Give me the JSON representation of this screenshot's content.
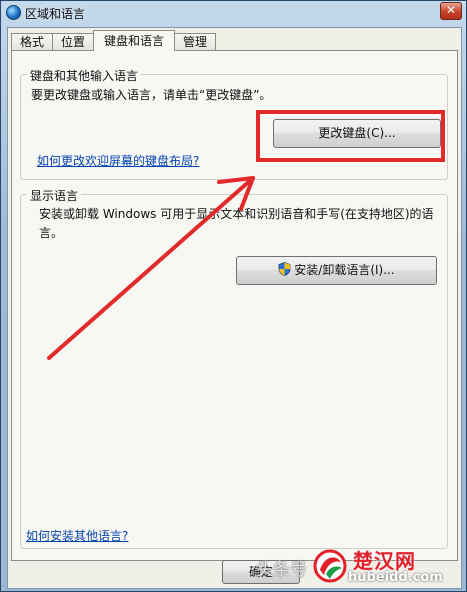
{
  "window": {
    "title": "区域和语言",
    "close_glyph": "✕"
  },
  "tabs": [
    {
      "label": "格式"
    },
    {
      "label": "位置"
    },
    {
      "label": "键盘和语言",
      "active": true
    },
    {
      "label": "管理"
    }
  ],
  "keyboard_group": {
    "title": "键盘和其他输入语言",
    "description": "要更改键盘或输入语言，请单击“更改键盘”。",
    "change_keyboard_button": "更改键盘(C)...",
    "welcome_layout_link": "如何更改欢迎屏幕的键盘布局?"
  },
  "display_language_group": {
    "title": "显示语言",
    "description_line1": "安装或卸载 Windows 可用于显示文本和识别语音和手写(在支持地区)的语",
    "description_line2": "言。",
    "install_button": "安装/卸载语言(I)..."
  },
  "footer": {
    "install_other_link": "如何安装其他语言?",
    "ok_button": "确定"
  },
  "watermark": {
    "text": "头条号",
    "brand": "楚汉网",
    "url": "hubeidd.com"
  },
  "annotation": {
    "color": "#e32a2a"
  },
  "icons": {
    "title_icon": "globe-icon",
    "shield_icon": "uac-shield-icon"
  }
}
